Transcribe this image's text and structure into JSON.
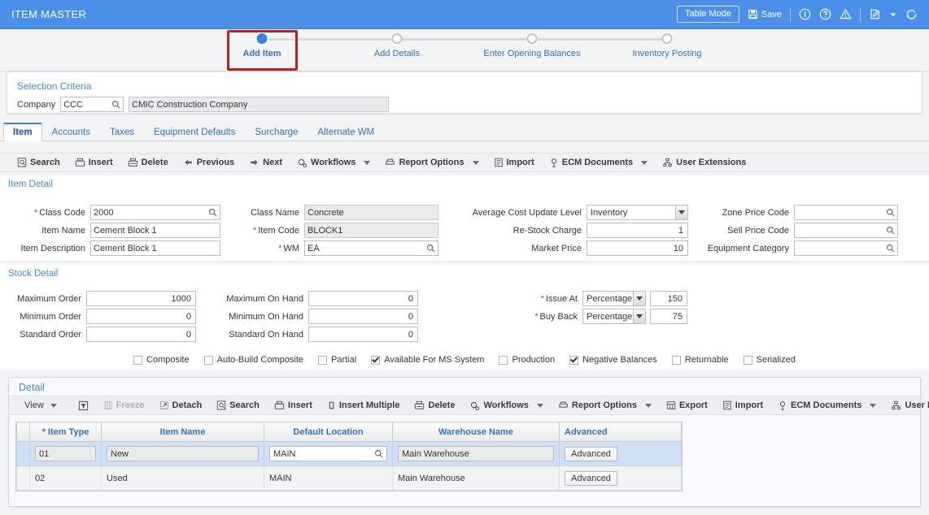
{
  "window": {
    "title": "ITEM MASTER"
  },
  "titlebar": {
    "table_mode": "Table Mode",
    "save": "Save",
    "icons": [
      "save-icon",
      "info-icon",
      "help-icon",
      "warning-icon",
      "edit-icon",
      "dropdown-caret",
      "refresh-icon"
    ]
  },
  "train": {
    "steps": [
      {
        "label": "Add Item",
        "active": true
      },
      {
        "label": "Add Details",
        "active": false
      },
      {
        "label": "Enter Opening Balances",
        "active": false
      },
      {
        "label": "Inventory Posting",
        "active": false
      }
    ],
    "highlight_step": "Add Item",
    "highlight_color": "#c0201f"
  },
  "selection_criteria": {
    "title": "Selection Criteria",
    "company_label": "Company",
    "company_code": "CCC",
    "company_name": "CMiC Construction Company"
  },
  "tabs": [
    {
      "label": "Item",
      "active": true
    },
    {
      "label": "Accounts",
      "active": false
    },
    {
      "label": "Taxes",
      "active": false
    },
    {
      "label": "Equipment Defaults",
      "active": false
    },
    {
      "label": "Surcharge",
      "active": false
    },
    {
      "label": "Alternate WM",
      "active": false
    }
  ],
  "main_toolbar": [
    {
      "label": "Search",
      "icon": "search-icon",
      "caret": false
    },
    {
      "label": "Insert",
      "icon": "insert-icon",
      "caret": false
    },
    {
      "label": "Delete",
      "icon": "delete-icon",
      "caret": false
    },
    {
      "label": "Previous",
      "icon": "arrow-left-icon",
      "caret": false
    },
    {
      "label": "Next",
      "icon": "arrow-right-icon",
      "caret": false
    },
    {
      "label": "Workflows",
      "icon": "workflows-icon",
      "caret": true
    },
    {
      "label": "Report Options",
      "icon": "printer-icon",
      "caret": true
    },
    {
      "label": "Import",
      "icon": "import-icon",
      "caret": false
    },
    {
      "label": "ECM Documents",
      "icon": "ecm-icon",
      "caret": true
    },
    {
      "label": "User Extensions",
      "icon": "user-extensions-icon",
      "caret": false
    }
  ],
  "item_detail": {
    "title": "Item Detail",
    "class_code": {
      "label": "Class Code",
      "value": "2000",
      "required": true
    },
    "item_name": {
      "label": "Item Name",
      "value": "Cement Block 1",
      "required": false
    },
    "item_description": {
      "label": "Item Description",
      "value": "Cement Block 1",
      "required": false
    },
    "class_name": {
      "label": "Class Name",
      "value": "Concrete",
      "required": false
    },
    "item_code": {
      "label": "Item Code",
      "value": "BLOCK1",
      "required": true
    },
    "wm": {
      "label": "WM",
      "value": "EA",
      "required": true
    },
    "avg_cost_update_level": {
      "label": "Average Cost Update Level",
      "value": "Inventory"
    },
    "restock_charge": {
      "label": "Re-Stock Charge",
      "value": "1"
    },
    "market_price": {
      "label": "Market Price",
      "value": "10"
    },
    "zone_price_code": {
      "label": "Zone Price Code",
      "value": ""
    },
    "sell_price_code": {
      "label": "Sell Price Code",
      "value": ""
    },
    "equipment_category": {
      "label": "Equipment Category",
      "value": ""
    }
  },
  "stock_detail": {
    "title": "Stock Detail",
    "maximum_order": {
      "label": "Maximum Order",
      "value": "1000"
    },
    "minimum_order": {
      "label": "Minimum Order",
      "value": "0"
    },
    "standard_order": {
      "label": "Standard Order",
      "value": "0"
    },
    "maximum_on_hand": {
      "label": "Maximum On Hand",
      "value": "0"
    },
    "minimum_on_hand": {
      "label": "Minimum On Hand",
      "value": "0"
    },
    "standard_on_hand": {
      "label": "Standard On Hand",
      "value": "0"
    },
    "issue_at": {
      "label": "Issue At",
      "mode": "Percentage",
      "value": "150",
      "required": true
    },
    "buy_back": {
      "label": "Buy Back",
      "mode": "Percentage",
      "value": "75",
      "required": true
    }
  },
  "checkboxes": [
    {
      "label": "Composite",
      "checked": false
    },
    {
      "label": "Auto-Build Composite",
      "checked": false
    },
    {
      "label": "Partial",
      "checked": false
    },
    {
      "label": "Available For MS System",
      "checked": true
    },
    {
      "label": "Production",
      "checked": false
    },
    {
      "label": "Negative Balances",
      "checked": true
    },
    {
      "label": "Returnable",
      "checked": false
    },
    {
      "label": "Serialized",
      "checked": false
    }
  ],
  "detail": {
    "title": "Detail",
    "toolbar": [
      {
        "label": "View",
        "icon": "view-icon",
        "caret": true,
        "disabled": false
      },
      {
        "label": "",
        "icon": "filter-icon",
        "caret": false,
        "disabled": false
      },
      {
        "label": "Freeze",
        "icon": "freeze-icon",
        "caret": false,
        "disabled": true
      },
      {
        "label": "Detach",
        "icon": "detach-icon",
        "caret": false,
        "disabled": false
      },
      {
        "label": "Search",
        "icon": "search-icon",
        "caret": false,
        "disabled": false
      },
      {
        "label": "Insert",
        "icon": "insert-icon",
        "caret": false,
        "disabled": false
      },
      {
        "label": "Insert Multiple",
        "icon": "insert-multiple-icon",
        "caret": false,
        "disabled": false
      },
      {
        "label": "Delete",
        "icon": "delete-icon",
        "caret": false,
        "disabled": false
      },
      {
        "label": "Workflows",
        "icon": "workflows-icon",
        "caret": true,
        "disabled": false
      },
      {
        "label": "Report Options",
        "icon": "printer-icon",
        "caret": true,
        "disabled": false
      },
      {
        "label": "Export",
        "icon": "export-icon",
        "caret": false,
        "disabled": false
      },
      {
        "label": "Import",
        "icon": "import-icon",
        "caret": false,
        "disabled": false
      },
      {
        "label": "ECM Documents",
        "icon": "ecm-icon",
        "caret": true,
        "disabled": false
      },
      {
        "label": "User Extensions",
        "icon": "user-extensions-icon",
        "caret": false,
        "disabled": false
      }
    ],
    "columns": [
      {
        "label": "* Item Type"
      },
      {
        "label": "Item Name"
      },
      {
        "label": "Default Location"
      },
      {
        "label": "Warehouse Name"
      },
      {
        "label": "Advanced"
      }
    ],
    "rows": [
      {
        "selected": true,
        "item_type": "01",
        "item_name": "New",
        "default_location": "MAIN",
        "warehouse_name": "Main Warehouse",
        "advanced": "Advanced"
      },
      {
        "selected": false,
        "item_type": "02",
        "item_name": "Used",
        "default_location": "MAIN",
        "warehouse_name": "Main Warehouse",
        "advanced": "Advanced"
      }
    ]
  },
  "colors": {
    "title_bar": "#4a90e8",
    "link_blue": "#2f6fd0",
    "section_header": "#3f8ae0",
    "highlight_red": "#c0201f",
    "selected_row": "#cfe0f5"
  }
}
